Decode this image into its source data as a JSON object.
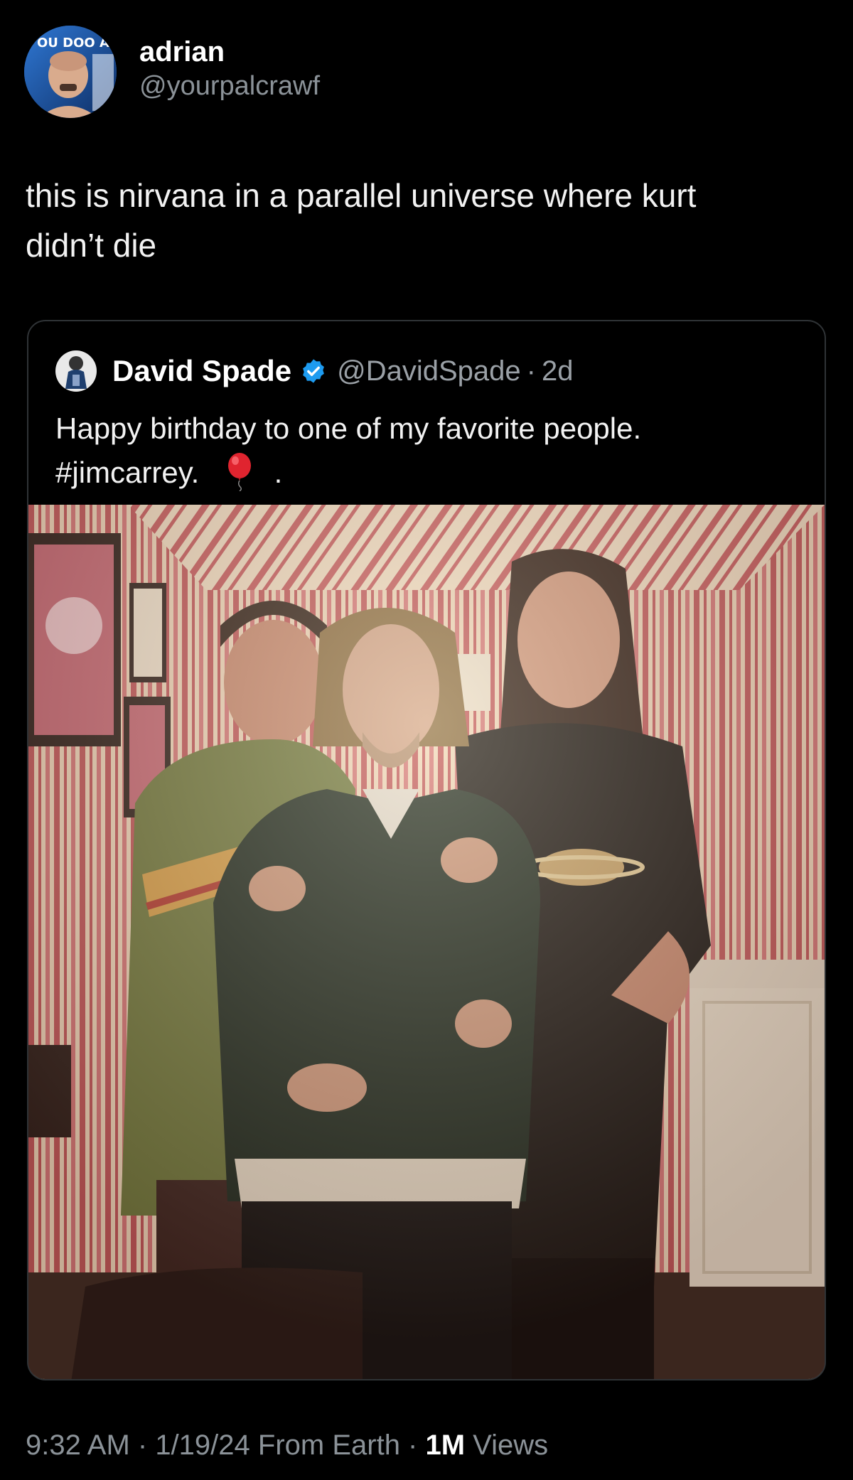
{
  "author": {
    "display_name": "adrian",
    "handle": "@yourpalcrawf",
    "avatar_icon": "user-avatar"
  },
  "tweet": {
    "text": "this is nirvana in a parallel universe where kurt\ndidn’t die"
  },
  "quoted": {
    "display_name": "David Spade",
    "verified": true,
    "verified_color": "#1d9bf0",
    "handle": "@DavidSpade",
    "separator": "·",
    "time_ago": "2d",
    "text_line1": "Happy birthday to one of my favorite people.",
    "text_hashtag": "#jimcarrey.",
    "text_trailing": ".",
    "emoji_icon": "balloon-icon",
    "photo_description_icon": "group-photo"
  },
  "footer": {
    "time": "9:32 AM",
    "sep1": " · ",
    "date": "1/19/24",
    "source": " From Earth",
    "sep2": " · ",
    "views_count": "1M",
    "views_label": " Views"
  },
  "colors": {
    "background": "#000000",
    "text": "#e7e9ea",
    "muted": "#8b9298",
    "border": "#2f3336",
    "wallpaper_red": "#c3575b",
    "wallpaper_cream": "#f3dcc0"
  }
}
